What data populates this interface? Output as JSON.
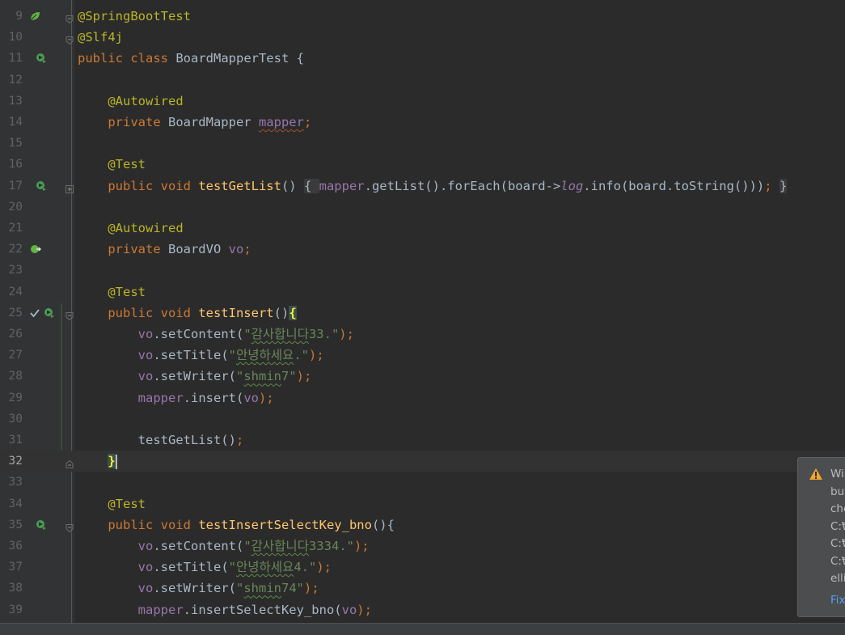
{
  "editor": {
    "lines": [
      {
        "n": "9",
        "code": [
          {
            "t": "@SpringBootTest",
            "c": "ann"
          }
        ]
      },
      {
        "n": "10",
        "code": [
          {
            "t": "@Slf4j",
            "c": "ann"
          }
        ]
      },
      {
        "n": "11",
        "code": [
          {
            "t": "public class ",
            "c": "kw"
          },
          {
            "t": "BoardMapperTest {"
          }
        ]
      },
      {
        "n": "12",
        "code": []
      },
      {
        "n": "13",
        "code": [
          {
            "t": "    "
          },
          {
            "t": "@Autowired",
            "c": "ann"
          }
        ]
      },
      {
        "n": "14",
        "code": [
          {
            "t": "    "
          },
          {
            "t": "private ",
            "c": "kw"
          },
          {
            "t": "BoardMapper "
          },
          {
            "t": "mapper",
            "c": "fld warnu"
          },
          {
            "t": ";",
            "c": "kw"
          }
        ]
      },
      {
        "n": "15",
        "code": []
      },
      {
        "n": "16",
        "code": [
          {
            "t": "    "
          },
          {
            "t": "@Test",
            "c": "ann"
          }
        ]
      },
      {
        "n": "17",
        "code": [
          {
            "t": "    "
          },
          {
            "t": "public void ",
            "c": "kw"
          },
          {
            "t": "testGetList",
            "c": "fn"
          },
          {
            "t": "() "
          },
          {
            "t": "{ ",
            "c": "fold-block"
          },
          {
            "t": "mapper",
            "c": "fld"
          },
          {
            "t": ".getList().forEach(board->"
          },
          {
            "t": "log",
            "c": "sfld"
          },
          {
            "t": ".info(board.toString()))"
          },
          {
            "t": ";",
            "c": "kw"
          },
          {
            "t": " "
          },
          {
            "t": "}",
            "c": "fold-block"
          }
        ]
      },
      {
        "n": "20",
        "code": []
      },
      {
        "n": "21",
        "code": [
          {
            "t": "    "
          },
          {
            "t": "@Autowired",
            "c": "ann"
          }
        ]
      },
      {
        "n": "22",
        "code": [
          {
            "t": "    "
          },
          {
            "t": "private ",
            "c": "kw"
          },
          {
            "t": "BoardVO "
          },
          {
            "t": "vo",
            "c": "fld"
          },
          {
            "t": ";",
            "c": "kw"
          }
        ]
      },
      {
        "n": "23",
        "code": []
      },
      {
        "n": "24",
        "code": [
          {
            "t": "    "
          },
          {
            "t": "@Test",
            "c": "ann"
          }
        ]
      },
      {
        "n": "25",
        "code": [
          {
            "t": "    "
          },
          {
            "t": "public void ",
            "c": "kw"
          },
          {
            "t": "testInsert",
            "c": "fn"
          },
          {
            "t": "()"
          },
          {
            "t": "{",
            "c": "brace-match"
          }
        ]
      },
      {
        "n": "26",
        "code": [
          {
            "t": "        "
          },
          {
            "t": "vo",
            "c": "fld"
          },
          {
            "t": ".setContent("
          },
          {
            "t": "\"",
            "c": "str"
          },
          {
            "t": "감사합니다",
            "c": "str typo"
          },
          {
            "t": "33.\"",
            "c": "str"
          },
          {
            "t": ");",
            "c": "kw"
          }
        ]
      },
      {
        "n": "27",
        "code": [
          {
            "t": "        "
          },
          {
            "t": "vo",
            "c": "fld"
          },
          {
            "t": ".setTitle("
          },
          {
            "t": "\"",
            "c": "str"
          },
          {
            "t": "안녕하세요",
            "c": "str typo"
          },
          {
            "t": ".\"",
            "c": "str"
          },
          {
            "t": ");",
            "c": "kw"
          }
        ]
      },
      {
        "n": "28",
        "code": [
          {
            "t": "        "
          },
          {
            "t": "vo",
            "c": "fld"
          },
          {
            "t": ".setWriter("
          },
          {
            "t": "\"",
            "c": "str"
          },
          {
            "t": "shmin",
            "c": "str typo"
          },
          {
            "t": "7\"",
            "c": "str"
          },
          {
            "t": ");",
            "c": "kw"
          }
        ]
      },
      {
        "n": "29",
        "code": [
          {
            "t": "        "
          },
          {
            "t": "mapper",
            "c": "fld"
          },
          {
            "t": ".insert("
          },
          {
            "t": "vo",
            "c": "fld"
          },
          {
            "t": ");",
            "c": "kw"
          }
        ]
      },
      {
        "n": "30",
        "code": []
      },
      {
        "n": "31",
        "code": [
          {
            "t": "        testGetList()"
          },
          {
            "t": ";",
            "c": "kw"
          }
        ]
      },
      {
        "n": "32",
        "code": [
          {
            "t": "    "
          },
          {
            "t": "}",
            "c": "brace-match"
          }
        ],
        "current": true
      },
      {
        "n": "33",
        "code": []
      },
      {
        "n": "34",
        "code": [
          {
            "t": "    "
          },
          {
            "t": "@Test",
            "c": "ann"
          }
        ]
      },
      {
        "n": "35",
        "code": [
          {
            "t": "    "
          },
          {
            "t": "public void ",
            "c": "kw"
          },
          {
            "t": "testInsertSelectKey_bno",
            "c": "fn"
          },
          {
            "t": "(){"
          }
        ]
      },
      {
        "n": "36",
        "code": [
          {
            "t": "        "
          },
          {
            "t": "vo",
            "c": "fld"
          },
          {
            "t": ".setContent("
          },
          {
            "t": "\"",
            "c": "str"
          },
          {
            "t": "감사합니다",
            "c": "str typo"
          },
          {
            "t": "3334.\"",
            "c": "str"
          },
          {
            "t": ");",
            "c": "kw"
          }
        ]
      },
      {
        "n": "37",
        "code": [
          {
            "t": "        "
          },
          {
            "t": "vo",
            "c": "fld"
          },
          {
            "t": ".setTitle("
          },
          {
            "t": "\"",
            "c": "str"
          },
          {
            "t": "안녕하세요",
            "c": "str typo"
          },
          {
            "t": "4.\"",
            "c": "str"
          },
          {
            "t": ");",
            "c": "kw"
          }
        ]
      },
      {
        "n": "38",
        "code": [
          {
            "t": "        "
          },
          {
            "t": "vo",
            "c": "fld"
          },
          {
            "t": ".setWriter("
          },
          {
            "t": "\"",
            "c": "str"
          },
          {
            "t": "shmin",
            "c": "str typo"
          },
          {
            "t": "74\"",
            "c": "str"
          },
          {
            "t": ");",
            "c": "kw"
          }
        ]
      },
      {
        "n": "39",
        "code": [
          {
            "t": "        "
          },
          {
            "t": "mapper",
            "c": "fld"
          },
          {
            "t": ".insertSelectKey_bno("
          },
          {
            "t": "vo",
            "c": "fld"
          },
          {
            "t": ");",
            "c": "kw"
          }
        ]
      }
    ]
  },
  "gutter_icons": {
    "spring_bean_icon": "spring-bean-icon",
    "run_test_icon": "run-test-icon",
    "check_icon": "check-icon",
    "fold_icon": "fold-icon"
  },
  "notification": {
    "lines": [
      "Wi",
      "bu",
      "che",
      "C:₩",
      "C:₩",
      "C:₩",
      "elli"
    ],
    "link": "Fix"
  },
  "colors": {
    "background": "#2b2b2b",
    "gutter": "#313335",
    "keyword": "#cc7832",
    "annotation": "#bbb529",
    "string": "#6a8759",
    "field": "#9876aa",
    "method": "#ffc66d",
    "default_text": "#a9b7c6",
    "warning": "#f0a732"
  }
}
